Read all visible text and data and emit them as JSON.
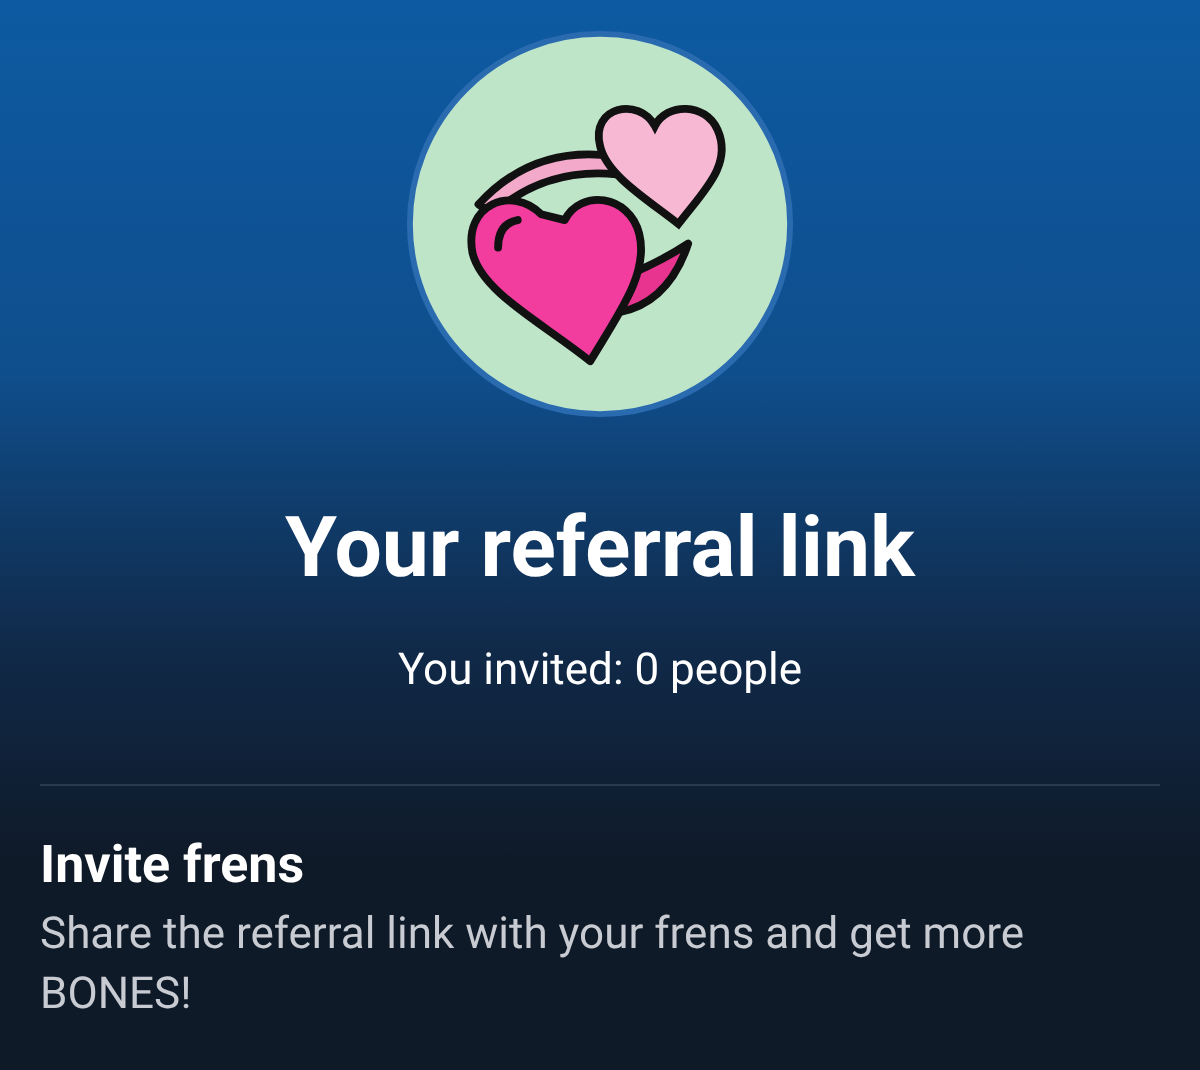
{
  "header": {
    "title": "Your referral link",
    "invited": "You invited: 0 people"
  },
  "invite": {
    "title": "Invite frens",
    "description": "Share the referral link with your frens and get more BONES!"
  }
}
